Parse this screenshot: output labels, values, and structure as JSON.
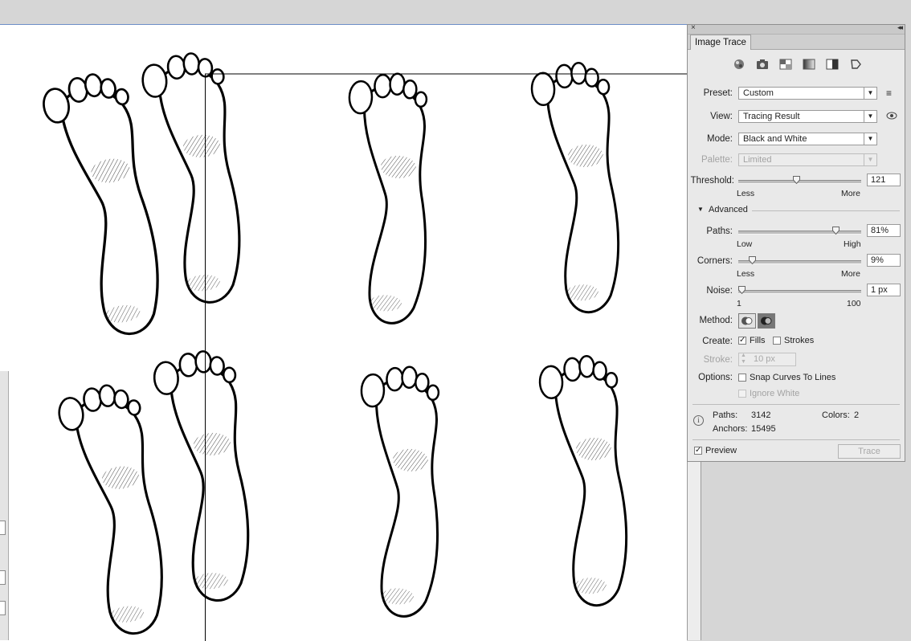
{
  "panel": {
    "tab_label": "Image Trace",
    "close_glyph": "×",
    "collapse_glyph": "◂◂",
    "icons": [
      "auto-color-icon",
      "high-color-icon",
      "low-color-icon",
      "grayscale-icon",
      "black-and-white-icon",
      "outline-icon"
    ],
    "preset": {
      "label": "Preset:",
      "value": "Custom"
    },
    "view": {
      "label": "View:",
      "value": "Tracing Result"
    },
    "mode": {
      "label": "Mode:",
      "value": "Black and White"
    },
    "palette": {
      "label": "Palette:",
      "value": "Limited"
    },
    "threshold": {
      "label": "Threshold:",
      "value": "121",
      "min_label": "Less",
      "max_label": "More",
      "level": 0.47
    },
    "advanced_label": "Advanced",
    "paths": {
      "label": "Paths:",
      "value": "81%",
      "min_label": "Low",
      "max_label": "High",
      "level": 0.81
    },
    "corners": {
      "label": "Corners:",
      "value": "9%",
      "min_label": "Less",
      "max_label": "More",
      "level": 0.09
    },
    "noise": {
      "label": "Noise:",
      "value": "1 px",
      "min_label": "1",
      "max_label": "100",
      "level": 0.0
    },
    "method_label": "Method:",
    "create": {
      "label": "Create:",
      "fills_label": "Fills",
      "fills_checked": true,
      "strokes_label": "Strokes",
      "strokes_checked": false
    },
    "stroke": {
      "label": "Stroke:",
      "value": "10 px"
    },
    "options": {
      "label": "Options:",
      "snap_label": "Snap Curves To Lines",
      "ignore_label": "Ignore White"
    },
    "info": {
      "paths_label": "Paths:",
      "paths_value": "3142",
      "colors_label": "Colors:",
      "colors_value": "2",
      "anchors_label": "Anchors:",
      "anchors_value": "15495"
    },
    "preview_label": "Preview",
    "trace_label": "Trace"
  }
}
